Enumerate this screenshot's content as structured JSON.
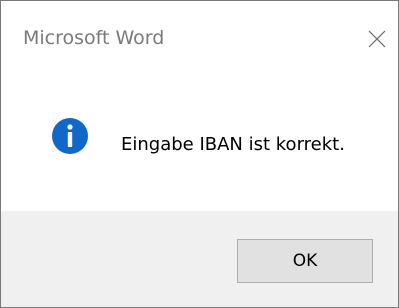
{
  "window": {
    "title": "Microsoft Word"
  },
  "dialog": {
    "icon": "information-icon",
    "message": "Eingabe IBAN ist korrekt."
  },
  "buttons": {
    "ok_label": "OK"
  },
  "colors": {
    "icon_blue": "#1168c9",
    "footer_bg": "#f0f0f0",
    "button_bg": "#e1e1e1",
    "title_text": "#7a7a7a"
  }
}
